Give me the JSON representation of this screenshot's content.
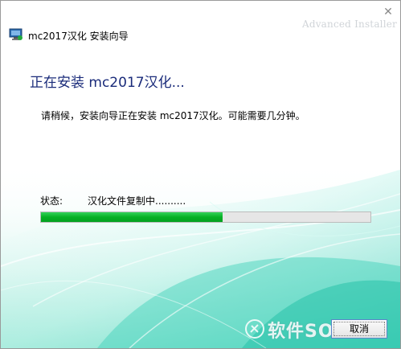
{
  "window": {
    "title": "mc2017汉化 安装向导",
    "brand": "Advanced Installer",
    "close_glyph": "✕"
  },
  "main": {
    "heading": "正在安装 mc2017汉化...",
    "description": "请稍候，安装向导正在安装 mc2017汉化。可能需要几分钟。",
    "status_label": "状态:",
    "status_value": "汉化文件复制中..........",
    "progress_fraction": 0.55
  },
  "footer": {
    "cancel_label": "取消",
    "watermark": "软件SOS"
  },
  "colors": {
    "heading": "#1a2b7a",
    "progress": "#06b025",
    "accent_teal": "#2ec9b0"
  },
  "icons": {
    "app": "installer-monitor-icon",
    "close": "close-icon",
    "watermark": "sos-logo-icon"
  }
}
